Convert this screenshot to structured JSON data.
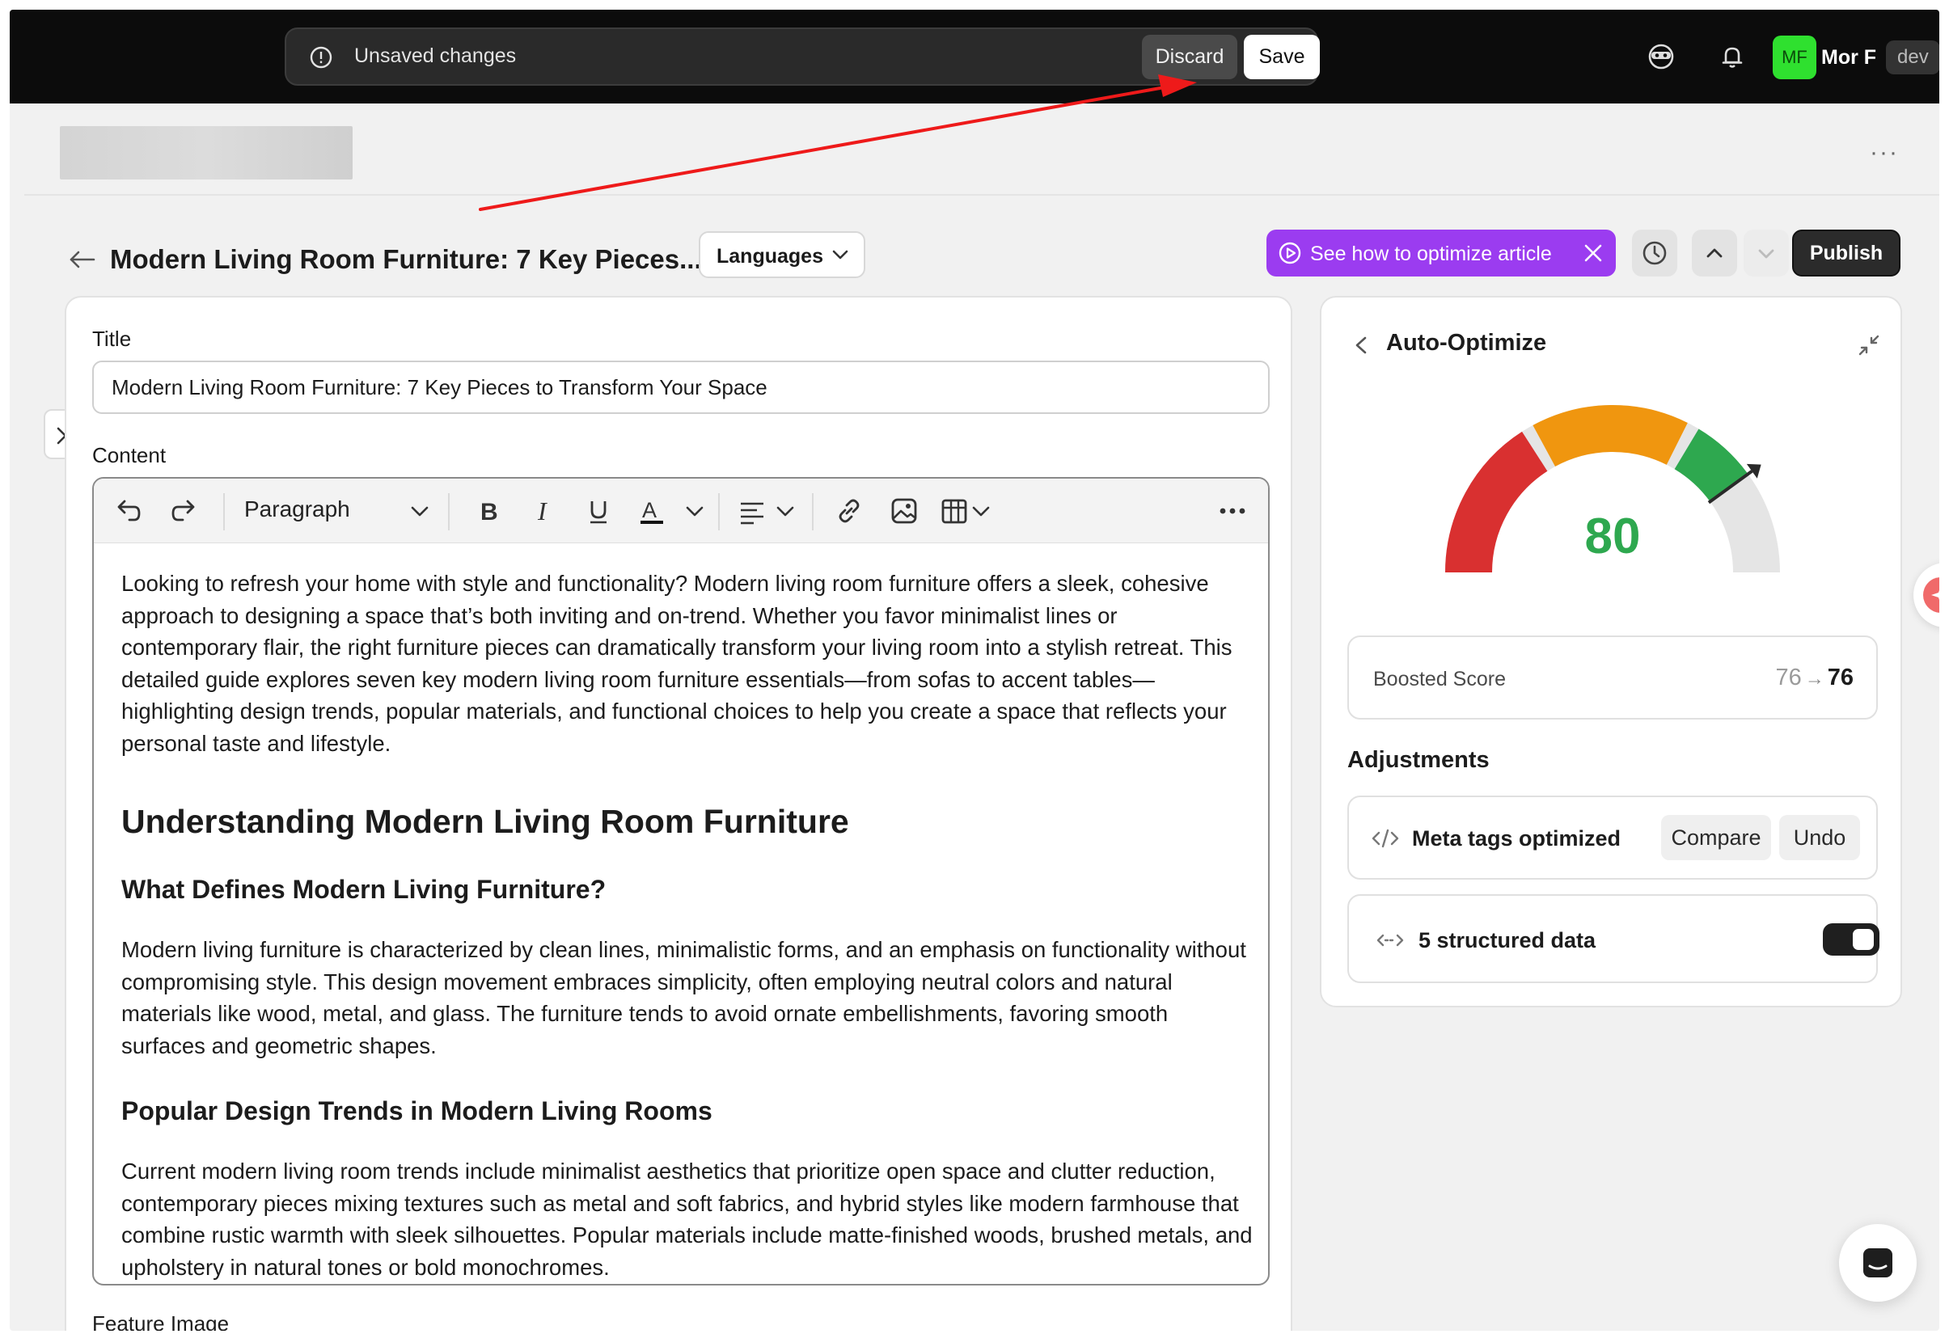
{
  "topbar": {
    "unsaved_message": "Unsaved changes",
    "discard_label": "Discard",
    "save_label": "Save",
    "user_initials": "MF",
    "user_name": "Mor F",
    "env_badge": "dev"
  },
  "header": {
    "more_label": "···"
  },
  "article": {
    "page_title": "Modern Living Room Furniture: 7 Key Pieces...",
    "languages_label": "Languages",
    "optimize_label": "See how to optimize article",
    "publish_label": "Publish"
  },
  "editor": {
    "title_label": "Title",
    "title_value": "Modern Living Room Furniture: 7 Key Pieces to Transform Your Space",
    "content_label": "Content",
    "block_type": "Paragraph",
    "feature_image_label": "Feature Image",
    "body": {
      "intro": "Looking to refresh your home with style and functionality? Modern living room furniture offers a sleek, cohesive approach to designing a space that’s both inviting and on-trend. Whether you favor minimalist lines or contemporary flair, the right furniture pieces can dramatically transform your living room into a stylish retreat. This detailed guide explores seven key modern living room furniture essentials—from sofas to accent tables—highlighting design trends, popular materials, and functional choices to help you create a space that reflects your personal taste and lifestyle.",
      "h2": "Understanding Modern Living Room Furniture",
      "h3_1": "What Defines Modern Living Furniture?",
      "p1": "Modern living furniture is characterized by clean lines, minimalistic forms, and an emphasis on functionality without compromising style. This design movement embraces simplicity, often employing neutral colors and natural materials like wood, metal, and glass. The furniture tends to avoid ornate embellishments, favoring smooth surfaces and geometric shapes.",
      "h3_2": "Popular Design Trends in Modern Living Rooms",
      "p2": "Current modern living room trends include minimalist aesthetics that prioritize open space and clutter reduction, contemporary pieces mixing textures such as metal and soft fabrics, and hybrid styles like modern farmhouse that combine rustic warmth with sleek silhouettes. Popular materials include matte-finished woods, brushed metals, and upholstery in natural tones or bold monochromes."
    }
  },
  "panel": {
    "title": "Auto-Optimize",
    "score": "80",
    "score_value": 80,
    "score_color": "#2ea84f",
    "boosted_label": "Boosted Score",
    "boosted_old": "76",
    "boosted_arrow": "→",
    "boosted_new": "76",
    "adjustments_title": "Adjustments",
    "meta_label": "Meta tags optimized",
    "compare_label": "Compare",
    "undo_label": "Undo",
    "structured_label": "5 structured data",
    "structured_enabled": true
  },
  "colors": {
    "accent_purple": "#9b3cf0",
    "gauge_red": "#d93030",
    "gauge_orange": "#f0960f",
    "gauge_green": "#2ea84f",
    "annotation_arrow": "#ee1a1a"
  }
}
